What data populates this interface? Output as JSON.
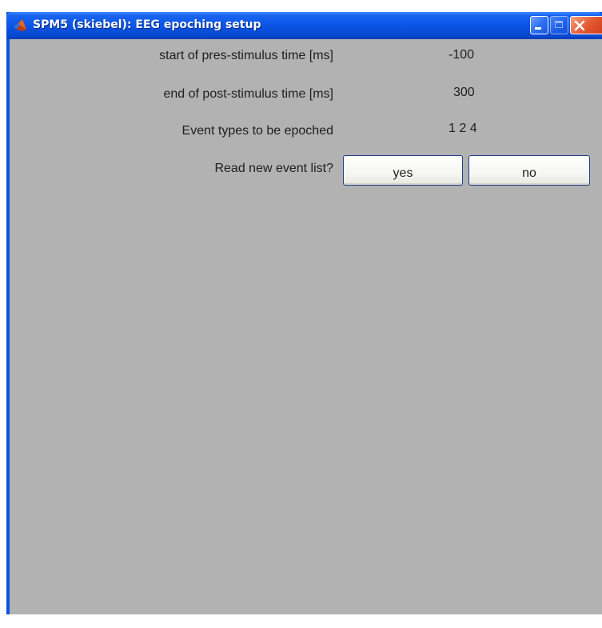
{
  "window": {
    "title": "SPM5 (skiebel): EEG epoching setup",
    "icon": "matlab-icon",
    "controls": [
      "minimize-icon",
      "maximize-icon",
      "close-icon"
    ]
  },
  "colors": {
    "titlebar": "#0a55e6",
    "client_background": "#b2b2b2",
    "close_button": "#e2562d",
    "text": "#202020"
  },
  "form": {
    "fields": [
      {
        "label": "start of pres-stimulus time [ms]",
        "value": "-100"
      },
      {
        "label": "end of post-stimulus time [ms]",
        "value": "300"
      },
      {
        "label": "Event types to be epoched",
        "value": "1 2 4"
      }
    ],
    "question": {
      "label": "Read new event list?",
      "yes_label": "yes",
      "no_label": "no"
    }
  }
}
